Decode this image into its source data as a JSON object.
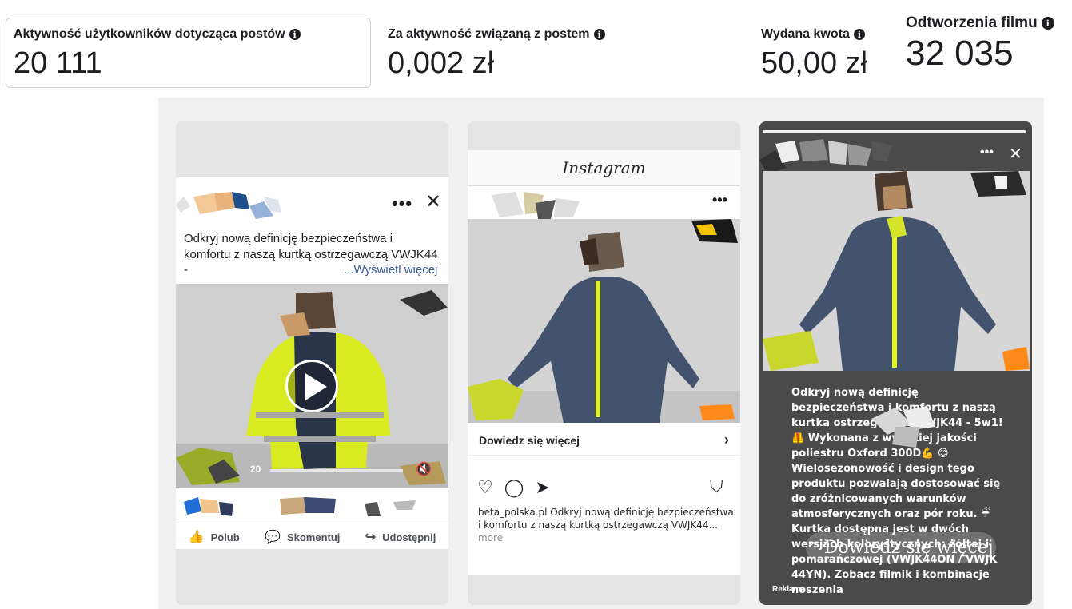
{
  "metrics": [
    {
      "label": "Aktywność użytkowników dotycząca postów",
      "value": "20 111"
    },
    {
      "label": "Za aktywność związaną z postem",
      "value": "0,002 zł"
    },
    {
      "label": "Wydana kwota",
      "value": "50,00 zł"
    },
    {
      "label": "Odtworzenia filmu",
      "value": "32 035"
    }
  ],
  "facebook_preview": {
    "caption": "Odkryj nową definicję bezpieczeństwa i komfortu z naszą kurtką ostrzegawczą VWJK44 -",
    "see_more": "...Wyświetl więcej",
    "video_time": "20",
    "actions": {
      "like": "Polub",
      "comment": "Skomentuj",
      "share": "Udostępnij"
    }
  },
  "instagram_preview": {
    "app_title": "Instagram",
    "cta": "Dowiedz się więcej",
    "account": "beta_polska.pl",
    "caption": "Odkryj nową definicję bezpieczeństwa i komfortu z naszą kurtką ostrzegawczą VWJK44...",
    "more": "more"
  },
  "story_preview": {
    "text": "Odkryj nową definicję bezpieczeństwa i komfortu z naszą kurtką ostrzegawczą VWJK44 - 5w1! 🦺 Wykonana z wysokiej jakości poliestru Oxford 300D💪 😊 Wielosezonowość i design tego produktu pozwalają dostosować się do zróżnicowanych warunków atmosferycznych oraz pór roku. ☔ Kurtka dostępna jest w dwóch wersjach kolorystycznych: żółtej i pomarańczowej (VWJK44ON / VWJK 44YN). Zobacz filmik i kombinacje noszenia",
    "cta": "Dowiedz się więcej",
    "sponsored": "Reklama"
  },
  "colors": {
    "jacket_navy": "#41506a",
    "hivis_yellow": "#d7ea2a",
    "story_overlay": "#4a4a4a",
    "link": "#385898"
  }
}
